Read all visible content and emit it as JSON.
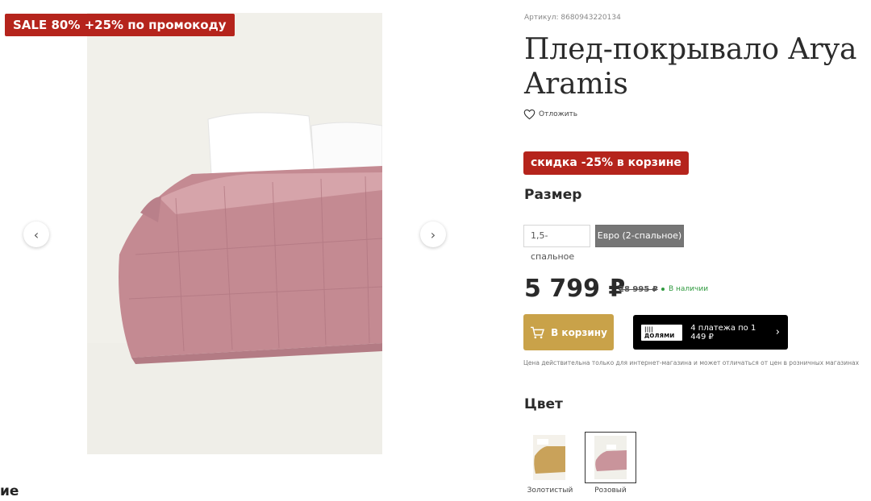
{
  "badges": {
    "sale": "SALE 80% +25% по промокоду",
    "discount": "скидка -25% в корзине"
  },
  "product": {
    "article": "Артикул: 8680943220134",
    "title": "Плед-покрывало Arya Aramis",
    "wishlist_label": "Отложить"
  },
  "size": {
    "title": "Размер",
    "options": [
      "1,5-спальное",
      "Евро (2-спальное)"
    ],
    "selected": "Евро (2-спальное)"
  },
  "pricing": {
    "price": "5 799 ₽",
    "old_price": "28 995 ₽",
    "stock": "В наличии",
    "note": "Цена действительна только для интернет-магазина и может отличаться от цен в розничных магазинах"
  },
  "actions": {
    "cart": "В корзину",
    "dolyami_logo": "|||| ДОЛЯМИ",
    "dolyami_text": "4 платежа по 1 449 ₽"
  },
  "color": {
    "title": "Цвет",
    "options": [
      {
        "label": "Золотистый",
        "swatch": "#c9a25a"
      },
      {
        "label": "Розовый",
        "swatch": "#c9949b"
      }
    ]
  },
  "page": {
    "cut_heading": "ие"
  },
  "icons": {
    "prev": "chevron-left-icon",
    "next": "chevron-right-icon",
    "wishlist": "heart-icon",
    "cart": "cart-icon",
    "dolyami": "chevron-right-icon"
  },
  "colors": {
    "accent_red": "#b5241c",
    "cart_gold": "#c9a249",
    "stock_green": "#2f9a3f"
  }
}
